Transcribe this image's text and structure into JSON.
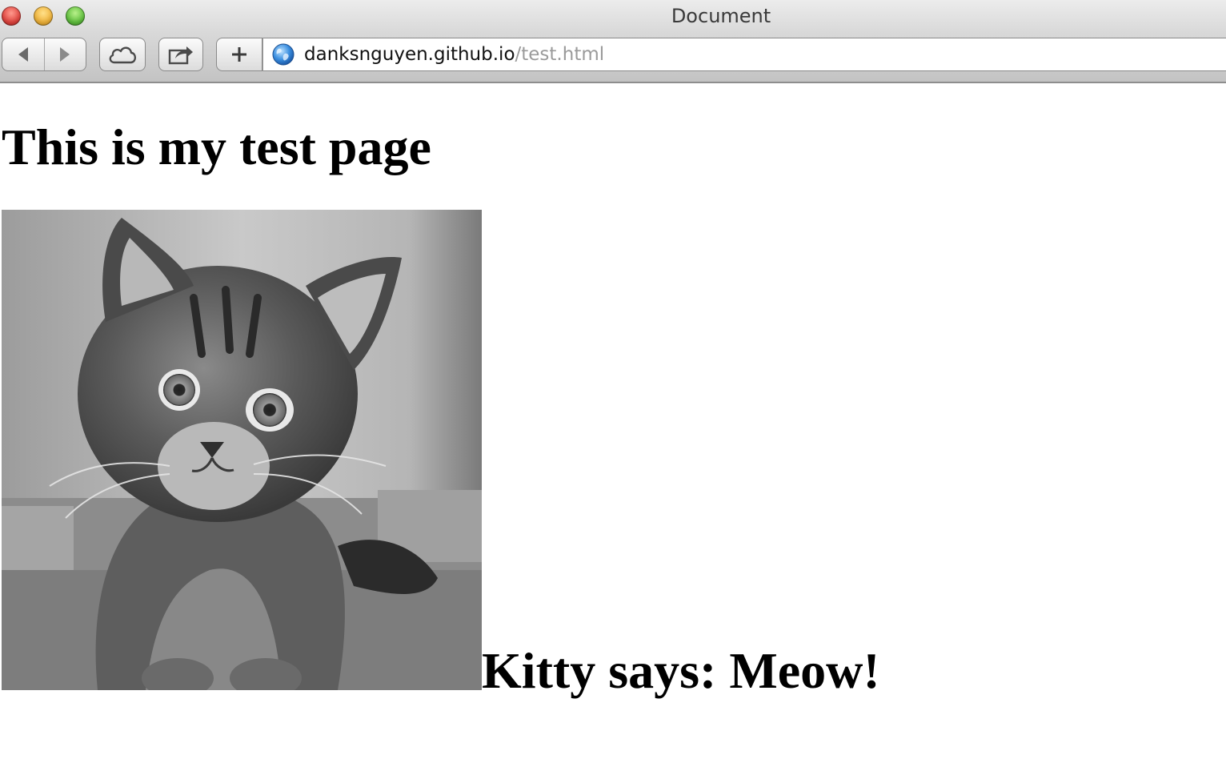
{
  "window": {
    "title": "Document"
  },
  "toolbar": {
    "back_icon": "back-arrow-icon",
    "forward_icon": "forward-arrow-icon",
    "cloud_icon": "icloud-tabs-icon",
    "share_icon": "share-icon",
    "new_tab_icon": "plus-icon"
  },
  "address_bar": {
    "domain": "danksnguyen.github.io",
    "path": "/test.html",
    "site_icon": "globe-icon"
  },
  "page": {
    "heading": "This is my test page",
    "image_icon": "kitten-photo",
    "caption": "Kitty says: Meow!"
  },
  "colors": {
    "url_path": "#9a9a9a",
    "close": "#e0443e",
    "minimize": "#f0b33a",
    "zoom": "#5fbf3d"
  }
}
